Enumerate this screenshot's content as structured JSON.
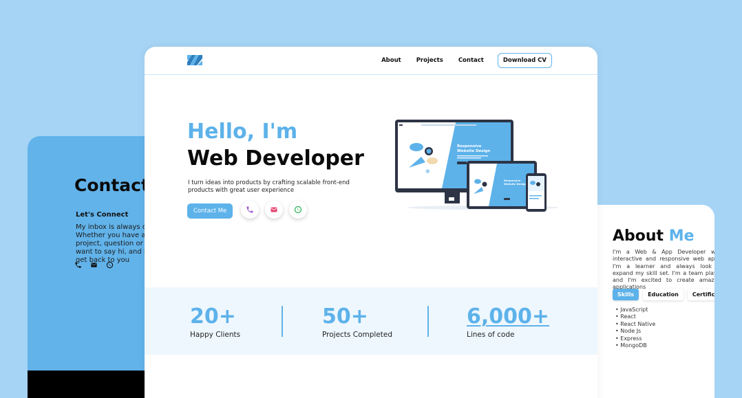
{
  "contact_card": {
    "title": "Contact",
    "subtitle": "Let's Connect",
    "text": "My inbox is always open. Whether you have a project, question or just want to say hi, and I will get back to you",
    "icons": [
      "phone-icon",
      "mail-icon",
      "whatsapp-icon"
    ]
  },
  "about_card": {
    "title_main": "About",
    "title_accent": "Me",
    "text": "I'm a Web & App Developer with interactive and responsive web apps. I'm a learner and always look to expand my skill set. I'm a team player and I'm excited to create amazing applications",
    "tabs": [
      "Skills",
      "Education",
      "Certifications"
    ],
    "skills": [
      "JavaScript",
      "React",
      "React Native",
      "Node Js",
      "Express",
      "MongoDB"
    ]
  },
  "nav": {
    "links": [
      "About",
      "Projects",
      "Contact"
    ],
    "cv_button": "Download CV"
  },
  "hero": {
    "greeting": "Hello, I'm",
    "role": "Web Developer",
    "description": "I turn ideas into products by crafting scalable front-end products with great user experience",
    "cta": "Contact Me",
    "illustration_text": "Responsive Website Design"
  },
  "stats": [
    {
      "value": "20+",
      "label": "Happy Clients"
    },
    {
      "value": "50+",
      "label": "Projects Completed"
    },
    {
      "value": "6,000+",
      "label": "Lines of code"
    }
  ],
  "colors": {
    "background": "#a6d4f5",
    "accent": "#5db2ea",
    "contact_card": "#62b3ea",
    "phone": "#9b59d0",
    "mail": "#e2456f",
    "whatsapp": "#25b04f"
  }
}
